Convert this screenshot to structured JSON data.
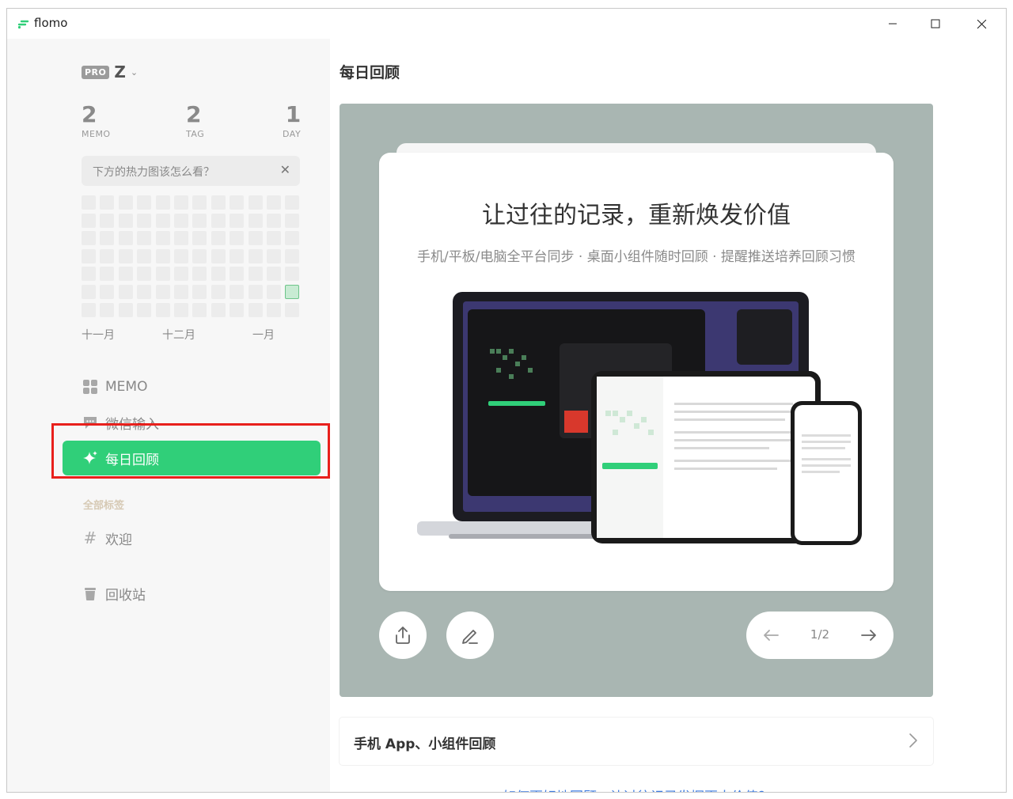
{
  "window": {
    "title": "flomo"
  },
  "sidebar": {
    "user": {
      "badge": "PRO",
      "name": "Z"
    },
    "stats": [
      {
        "value": "2",
        "label": "MEMO"
      },
      {
        "value": "2",
        "label": "TAG"
      },
      {
        "value": "1",
        "label": "DAY"
      }
    ],
    "tip": {
      "text": "下方的热力图该怎么看？"
    },
    "heatmap": {
      "rows": 7,
      "cols": 12,
      "active_cells": [
        [
          5,
          11
        ]
      ]
    },
    "months": [
      "十一月",
      "十二月",
      "一月"
    ],
    "nav": [
      {
        "label": "MEMO",
        "icon": "grid-icon"
      },
      {
        "label": "微信输入",
        "icon": "chat-icon"
      },
      {
        "label": "每日回顾",
        "icon": "sparkle-icon",
        "active": true
      }
    ],
    "section_label": "全部标签",
    "tags": [
      {
        "label": "欢迎",
        "icon": "hash-icon"
      }
    ],
    "trash": {
      "label": "回收站",
      "icon": "trash-icon"
    }
  },
  "main": {
    "title": "每日回顾",
    "card": {
      "title": "让过往的记录，重新焕发价值",
      "subtitle": "手机/平板/电脑全平台同步 · 桌面小组件随时回顾 · 提醒推送培养回顾习惯"
    },
    "pager": {
      "text": "1/2"
    },
    "app_link": {
      "label": "手机 App、小组件回顾"
    },
    "bottom_link": "如何更好地回顾，让过往记录发挥更大价值？"
  },
  "colors": {
    "accent": "#30cf79",
    "panel": "#a9b6b2",
    "highlight": "#e8201c"
  }
}
